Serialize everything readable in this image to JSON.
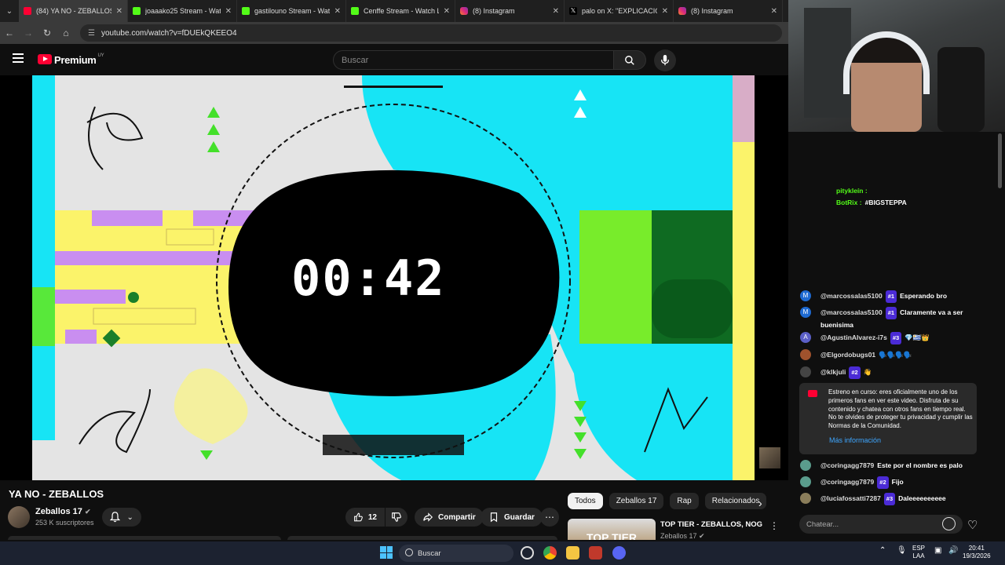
{
  "tabs": [
    {
      "title": "(84) YA NO - ZEBALLOS",
      "icon": "youtube-icon",
      "active": true
    },
    {
      "title": "joaaako25 Stream - Watch",
      "icon": "kick-icon"
    },
    {
      "title": "gastilouno Stream - Watch",
      "icon": "kick-icon"
    },
    {
      "title": "Cenffe Stream - Watch Live",
      "icon": "kick-icon"
    },
    {
      "title": "(8) Instagram",
      "icon": "instagram-icon"
    },
    {
      "title": "palo on X: \"EXPLICACION",
      "icon": "x-icon"
    },
    {
      "title": "(8) Instagram",
      "icon": "instagram-icon"
    }
  ],
  "address": {
    "url": "youtube.com/watch?v=fDUEkQKEEO4"
  },
  "header": {
    "brand": "Premium",
    "region": "UY",
    "search_placeholder": "Buscar"
  },
  "video": {
    "timer": "00:42"
  },
  "info": {
    "title": "YA NO - ZEBALLOS",
    "channel": "Zeballos 17",
    "subscribers": "253 K suscriptores",
    "likes": "12",
    "share_label": "Compartir",
    "save_label": "Guardar"
  },
  "chips": [
    "Todos",
    "Zeballos 17",
    "Rap",
    "Relacionados"
  ],
  "recommended": {
    "title": "TOP TIER - ZEBALLOS, NOG",
    "channel": "Zeballos 17",
    "thumb_text": "TOP TIER"
  },
  "chat": {
    "top_messages": [
      {
        "user": "pitykleín :",
        "text": "",
        "color": "#3ea6ff"
      },
      {
        "user": "BotRix :",
        "text": "#BIGSTEPPA",
        "color": "#53fc18"
      }
    ],
    "messages": [
      {
        "user": "@marcossalas5100",
        "badge": "#1",
        "text": "Esperando bro",
        "avatar": "M",
        "avatar_color": "#1e6ad1"
      },
      {
        "user": "@marcossalas5100",
        "badge": "#1",
        "text": "Claramente va a ser buenisima",
        "avatar": "M",
        "avatar_color": "#1e6ad1"
      },
      {
        "user": "@AgustinAlvarez-i7s",
        "badge": "#3",
        "text": "💎🇺🇾👑",
        "avatar": "A",
        "avatar_color": "#5b5fc7"
      },
      {
        "user": "@Elgordobugs01",
        "badge": "",
        "text": "🗣️🗣️🗣️🗣️",
        "avatar": "",
        "avatar_color": "#a0522d"
      },
      {
        "user": "@klkjuli",
        "badge": "#2",
        "text": "👋",
        "avatar": "",
        "avatar_color": "#444"
      },
      {
        "user": "@coringagg7879",
        "badge": "",
        "text": "Este por el nombre es palo",
        "avatar": "",
        "avatar_color": "#5a9c8c"
      },
      {
        "user": "@coringagg7879",
        "badge": "#2",
        "text": "Fijo",
        "avatar": "",
        "avatar_color": "#5a9c8c"
      },
      {
        "user": "@luciafossatti7287",
        "badge": "#3",
        "text": "Daleeeeeeeeee",
        "avatar": "",
        "avatar_color": "#8a7d5a"
      }
    ],
    "notice": "Estreno en curso: eres oficialmente uno de los primeros fans en ver este video. Disfruta de su contenido y chatea con otros fans en tiempo real. No te olvides de proteger tu privacidad y cumplir las Normas de la Comunidad.",
    "notice_link": "Más información",
    "input_placeholder": "Chatear..."
  },
  "taskbar": {
    "search": "Buscar",
    "lang": "ESP",
    "lang2": "LAA",
    "time": "20:41",
    "date": "19/3/2026"
  }
}
